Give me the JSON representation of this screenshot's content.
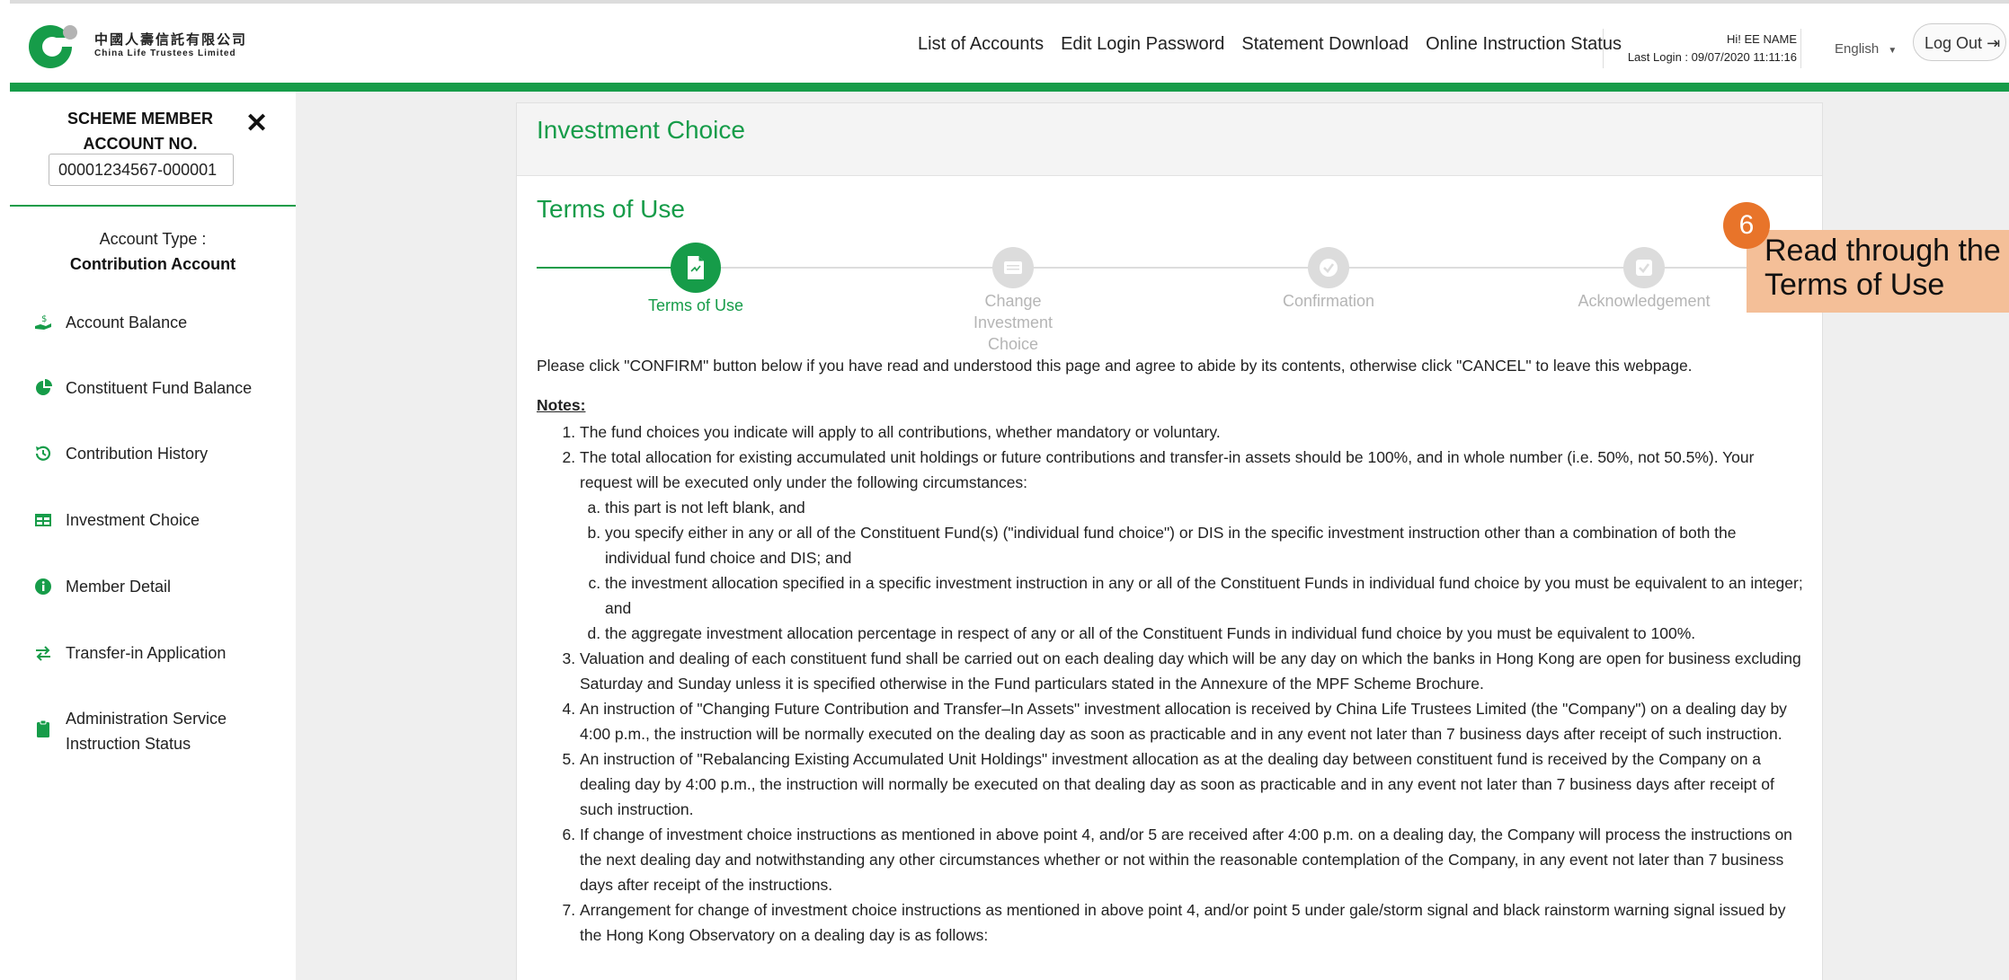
{
  "header": {
    "logo_cn": "中國人壽信託有限公司",
    "logo_en": "China Life Trustees Limited",
    "nav": [
      "List of Accounts",
      "Edit Login Password",
      "Statement Download",
      "Online Instruction Status"
    ],
    "greeting": "Hi! EE NAME",
    "last_login": "Last Login : 09/07/2020 11:11:16",
    "language": "English",
    "logout": "Log Out"
  },
  "sidebar": {
    "heading": "SCHEME MEMBER ACCOUNT NO.",
    "account_no": "00001234567-000001",
    "account_type_label": "Account Type :",
    "account_type_value": "Contribution Account",
    "items": [
      {
        "label": "Account Balance",
        "icon": "hand-coin-icon"
      },
      {
        "label": "Constituent Fund Balance",
        "icon": "pie-chart-icon"
      },
      {
        "label": "Contribution History",
        "icon": "history-icon"
      },
      {
        "label": "Investment Choice",
        "icon": "table-icon"
      },
      {
        "label": "Member Detail",
        "icon": "info-icon"
      },
      {
        "label": "Transfer-in Application",
        "icon": "transfer-icon"
      },
      {
        "label": "Administration Service Instruction Status",
        "icon": "clipboard-icon"
      }
    ]
  },
  "main": {
    "panel_title": "Investment Choice",
    "section_title": "Terms of Use",
    "steps": [
      {
        "label": "Terms of Use",
        "icon": "document-icon"
      },
      {
        "label": "Change Investment Choice",
        "icon": "keyboard-icon"
      },
      {
        "label": "Confirmation",
        "icon": "check-icon"
      },
      {
        "label": "Acknowledgement",
        "icon": "checkbox-icon"
      }
    ],
    "intro": "Please click \"CONFIRM\" button below if you have read and understood this page and agree to abide by its contents, otherwise click \"CANCEL\" to leave this webpage.",
    "notes_heading": "Notes:",
    "notes": {
      "n1": "The fund choices you indicate will apply to all contributions, whether mandatory or voluntary.",
      "n2": "The total allocation for existing accumulated unit holdings or future contributions and transfer-in assets should be 100%, and in whole number (i.e. 50%, not 50.5%). Your request will be executed only under the following circumstances:",
      "n2a": "this part is not left blank, and",
      "n2b": "you specify either in any or all of the Constituent Fund(s) (\"individual fund choice\") or DIS in the specific investment instruction other than a combination of both the individual fund choice and DIS; and",
      "n2c": "the investment allocation specified in a specific investment instruction in any or all of the Constituent Funds in individual fund choice by you must be equivalent to an integer; and",
      "n2d": "the aggregate investment allocation percentage in respect of any or all of the Constituent Funds in individual fund choice by you must be equivalent to 100%.",
      "n3": "Valuation and dealing of each constituent fund shall be carried out on each dealing day which will be any day on which the banks in Hong Kong are open for business excluding Saturday and Sunday unless it is specified otherwise in the Fund particulars stated in the Annexure of the MPF Scheme Brochure.",
      "n4": "An instruction of \"Changing Future Contribution and Transfer–In Assets\" investment allocation is received by China Life Trustees Limited (the \"Company\") on a dealing day by 4:00 p.m., the instruction will be normally executed on the dealing day as soon as practicable and in any event not later than 7 business days after receipt of such instruction.",
      "n5": "An instruction of \"Rebalancing Existing Accumulated Unit Holdings\" investment allocation as at the dealing day between constituent fund is received by the Company on a dealing day by 4:00 p.m., the instruction will normally be executed on that dealing day as soon as practicable and in any event not later than 7 business days after receipt of such instruction.",
      "n6": "If change of investment choice instructions as mentioned in above point 4, and/or 5 are received after 4:00 p.m. on a dealing day, the Company will process the instructions on the next dealing day and notwithstanding any other circumstances whether or not within the reasonable contemplation of the Company, in any event not later than 7 business days after receipt of the instructions.",
      "n7": "Arrangement for change of investment choice instructions as mentioned in above point 4, and/or point 5 under gale/storm signal and black rainstorm warning signal issued by the Hong Kong Observatory on a dealing day is as follows:"
    }
  },
  "callout": {
    "number": "6",
    "text": "Read through the Terms of Use"
  },
  "colors": {
    "brand_green": "#169c49",
    "callout_orange": "#e8742a",
    "callout_bg": "#f4bf98"
  }
}
